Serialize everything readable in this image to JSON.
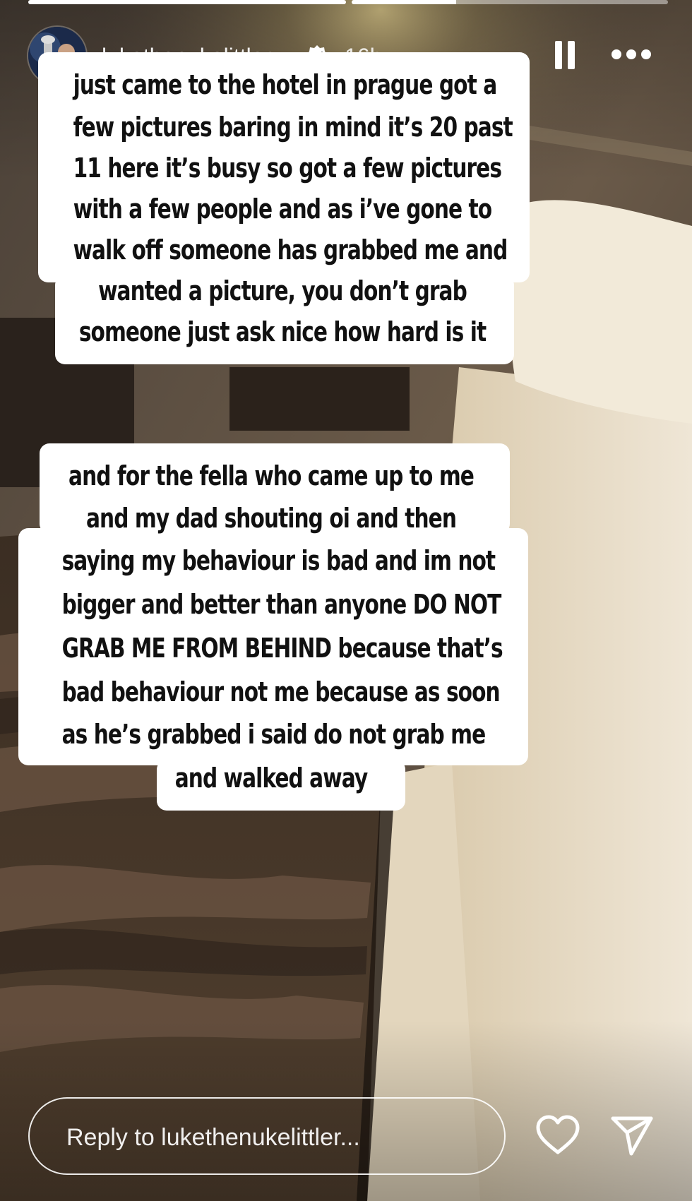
{
  "story": {
    "progress": [
      1.0,
      0.33
    ],
    "author": {
      "username": "lukethenukelittler",
      "verified": true,
      "time_ago": "16h"
    },
    "controls": {
      "pause_icon": "pause-icon",
      "more_icon": "more-options-icon"
    },
    "captions": [
      {
        "lines": [
          "just came to the hotel in prague got a",
          "few pictures baring in mind it’s 20 past",
          "11 here it’s busy so got a few pictures",
          "with a few people and as i’ve gone to",
          "walk off someone has grabbed me and",
          "wanted a picture, you don’t grab",
          "someone just ask nice how hard is it"
        ]
      },
      {
        "lines": [
          "and for the fella who came up to me",
          "and my dad shouting oi and then",
          "saying my behaviour is bad and im not",
          "bigger and better than anyone DO NOT",
          "GRAB ME FROM BEHIND because that’s",
          "bad behaviour not me because as soon",
          "as he’s grabbed i said do not grab me",
          "and walked away"
        ]
      }
    ]
  },
  "footer": {
    "reply_placeholder": "Reply to lukethenukelittler...",
    "like_icon": "heart-icon",
    "share_icon": "send-icon"
  },
  "colors": {
    "caption_background": "#ffffff",
    "caption_text": "#111111",
    "overlay_text": "#ffffff"
  }
}
